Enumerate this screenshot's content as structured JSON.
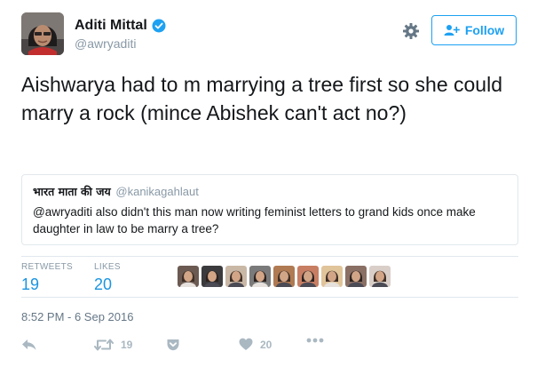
{
  "author": {
    "display_name": "Aditi Mittal",
    "handle": "@awryaditi",
    "avatar_icon": "avatar-photo",
    "verified_icon": "verified-badge-icon"
  },
  "header": {
    "follow_label": "Follow",
    "settings_icon": "gear-icon"
  },
  "tweet": {
    "text": "Aishwarya had to m marrying a tree first so she could marry a rock (mince Abishek can't act no?)"
  },
  "quoted_tweet": {
    "name": "भारत माता की जय",
    "handle": "@kanikagahlaut",
    "text": "@awryaditi also didn't this man now writing feminist letters to grand kids once make daughter in law to be marry a tree?"
  },
  "stats": {
    "retweets_label": "RETWEETS",
    "retweets_value": "19",
    "likes_label": "LIKES",
    "likes_value": "20"
  },
  "liked_by_avatars": [
    "#6b5a52",
    "#3b3a3c",
    "#c9b8a6",
    "#7a7a7a",
    "#b07a52",
    "#c77e63",
    "#e0c49a",
    "#8a6f64",
    "#d9cfc8"
  ],
  "timestamp": "8:52 PM - 6 Sep 2016",
  "actions": {
    "reply_icon": "reply-icon",
    "retweet_icon": "retweet-icon",
    "retweet_count": "19",
    "pocket_icon": "pocket-icon",
    "like_icon": "heart-icon",
    "like_count": "20",
    "more_icon": "more-icon"
  },
  "colors": {
    "accent": "#1da1f2",
    "link_blue": "#1b95e0",
    "muted": "#8899a6",
    "action_gray": "#aab8c2",
    "border": "#e1e8ed"
  }
}
